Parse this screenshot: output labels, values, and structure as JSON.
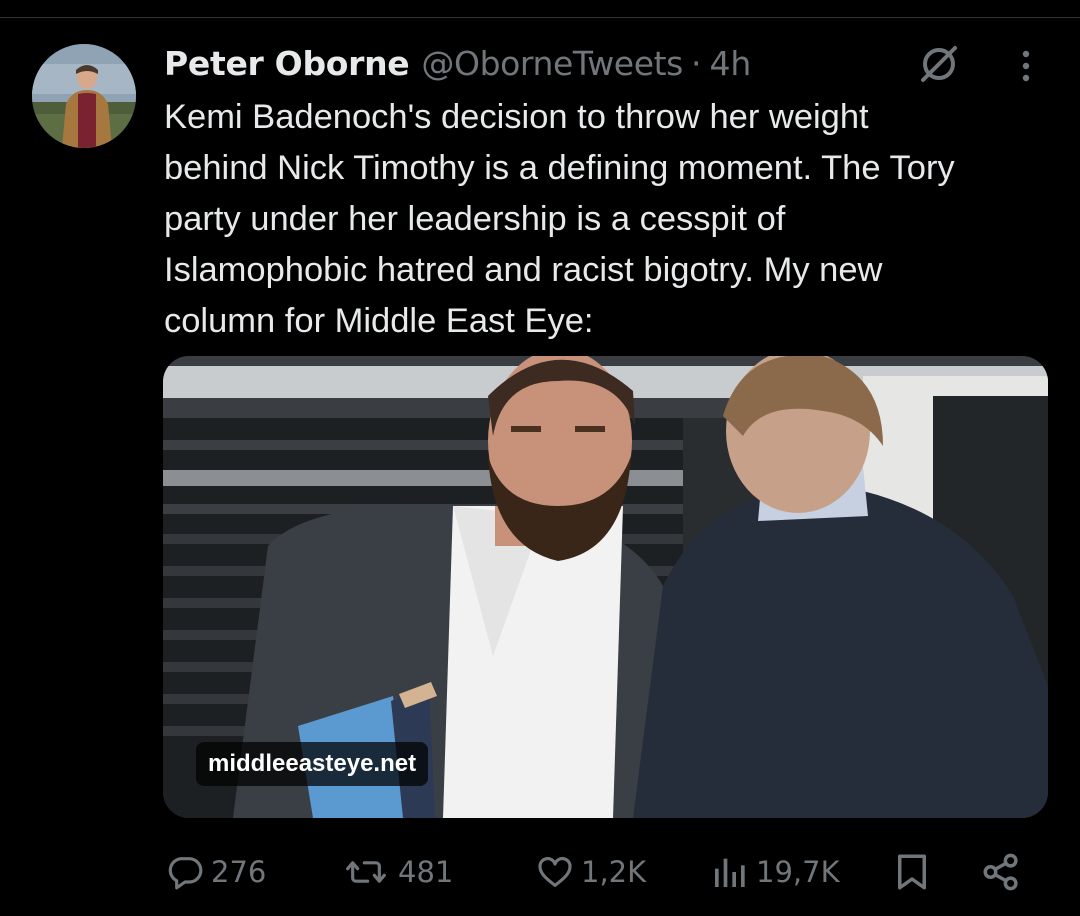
{
  "tweet": {
    "author": {
      "display_name": "Peter Oborne",
      "handle": "@OborneTweets"
    },
    "separator": "·",
    "time": "4h",
    "text_lines": [
      "Kemi Badenoch's decision to throw her weight",
      "behind Nick Timothy is a defining moment. The Tory",
      "party under her leadership is a cesspit of",
      "Islamophobic hatred and racist bigotry. My new",
      "column for Middle East Eye:"
    ],
    "link_card": {
      "domain": "middleeasteye.net"
    },
    "actions": {
      "replies": "276",
      "reposts": "481",
      "likes": "1,2K",
      "views": "19,7K"
    }
  },
  "icons": {
    "reply": "speech-bubble-icon",
    "repost": "repost-arrows-icon",
    "like": "heart-icon",
    "views": "bar-chart-icon",
    "bookmark": "bookmark-icon",
    "share": "share-nodes-icon",
    "grok": "grok-slash-circle-icon",
    "more": "vertical-dots-icon"
  },
  "colors": {
    "background": "#000000",
    "text_primary": "#e7e9ea",
    "text_secondary": "#71767b"
  }
}
